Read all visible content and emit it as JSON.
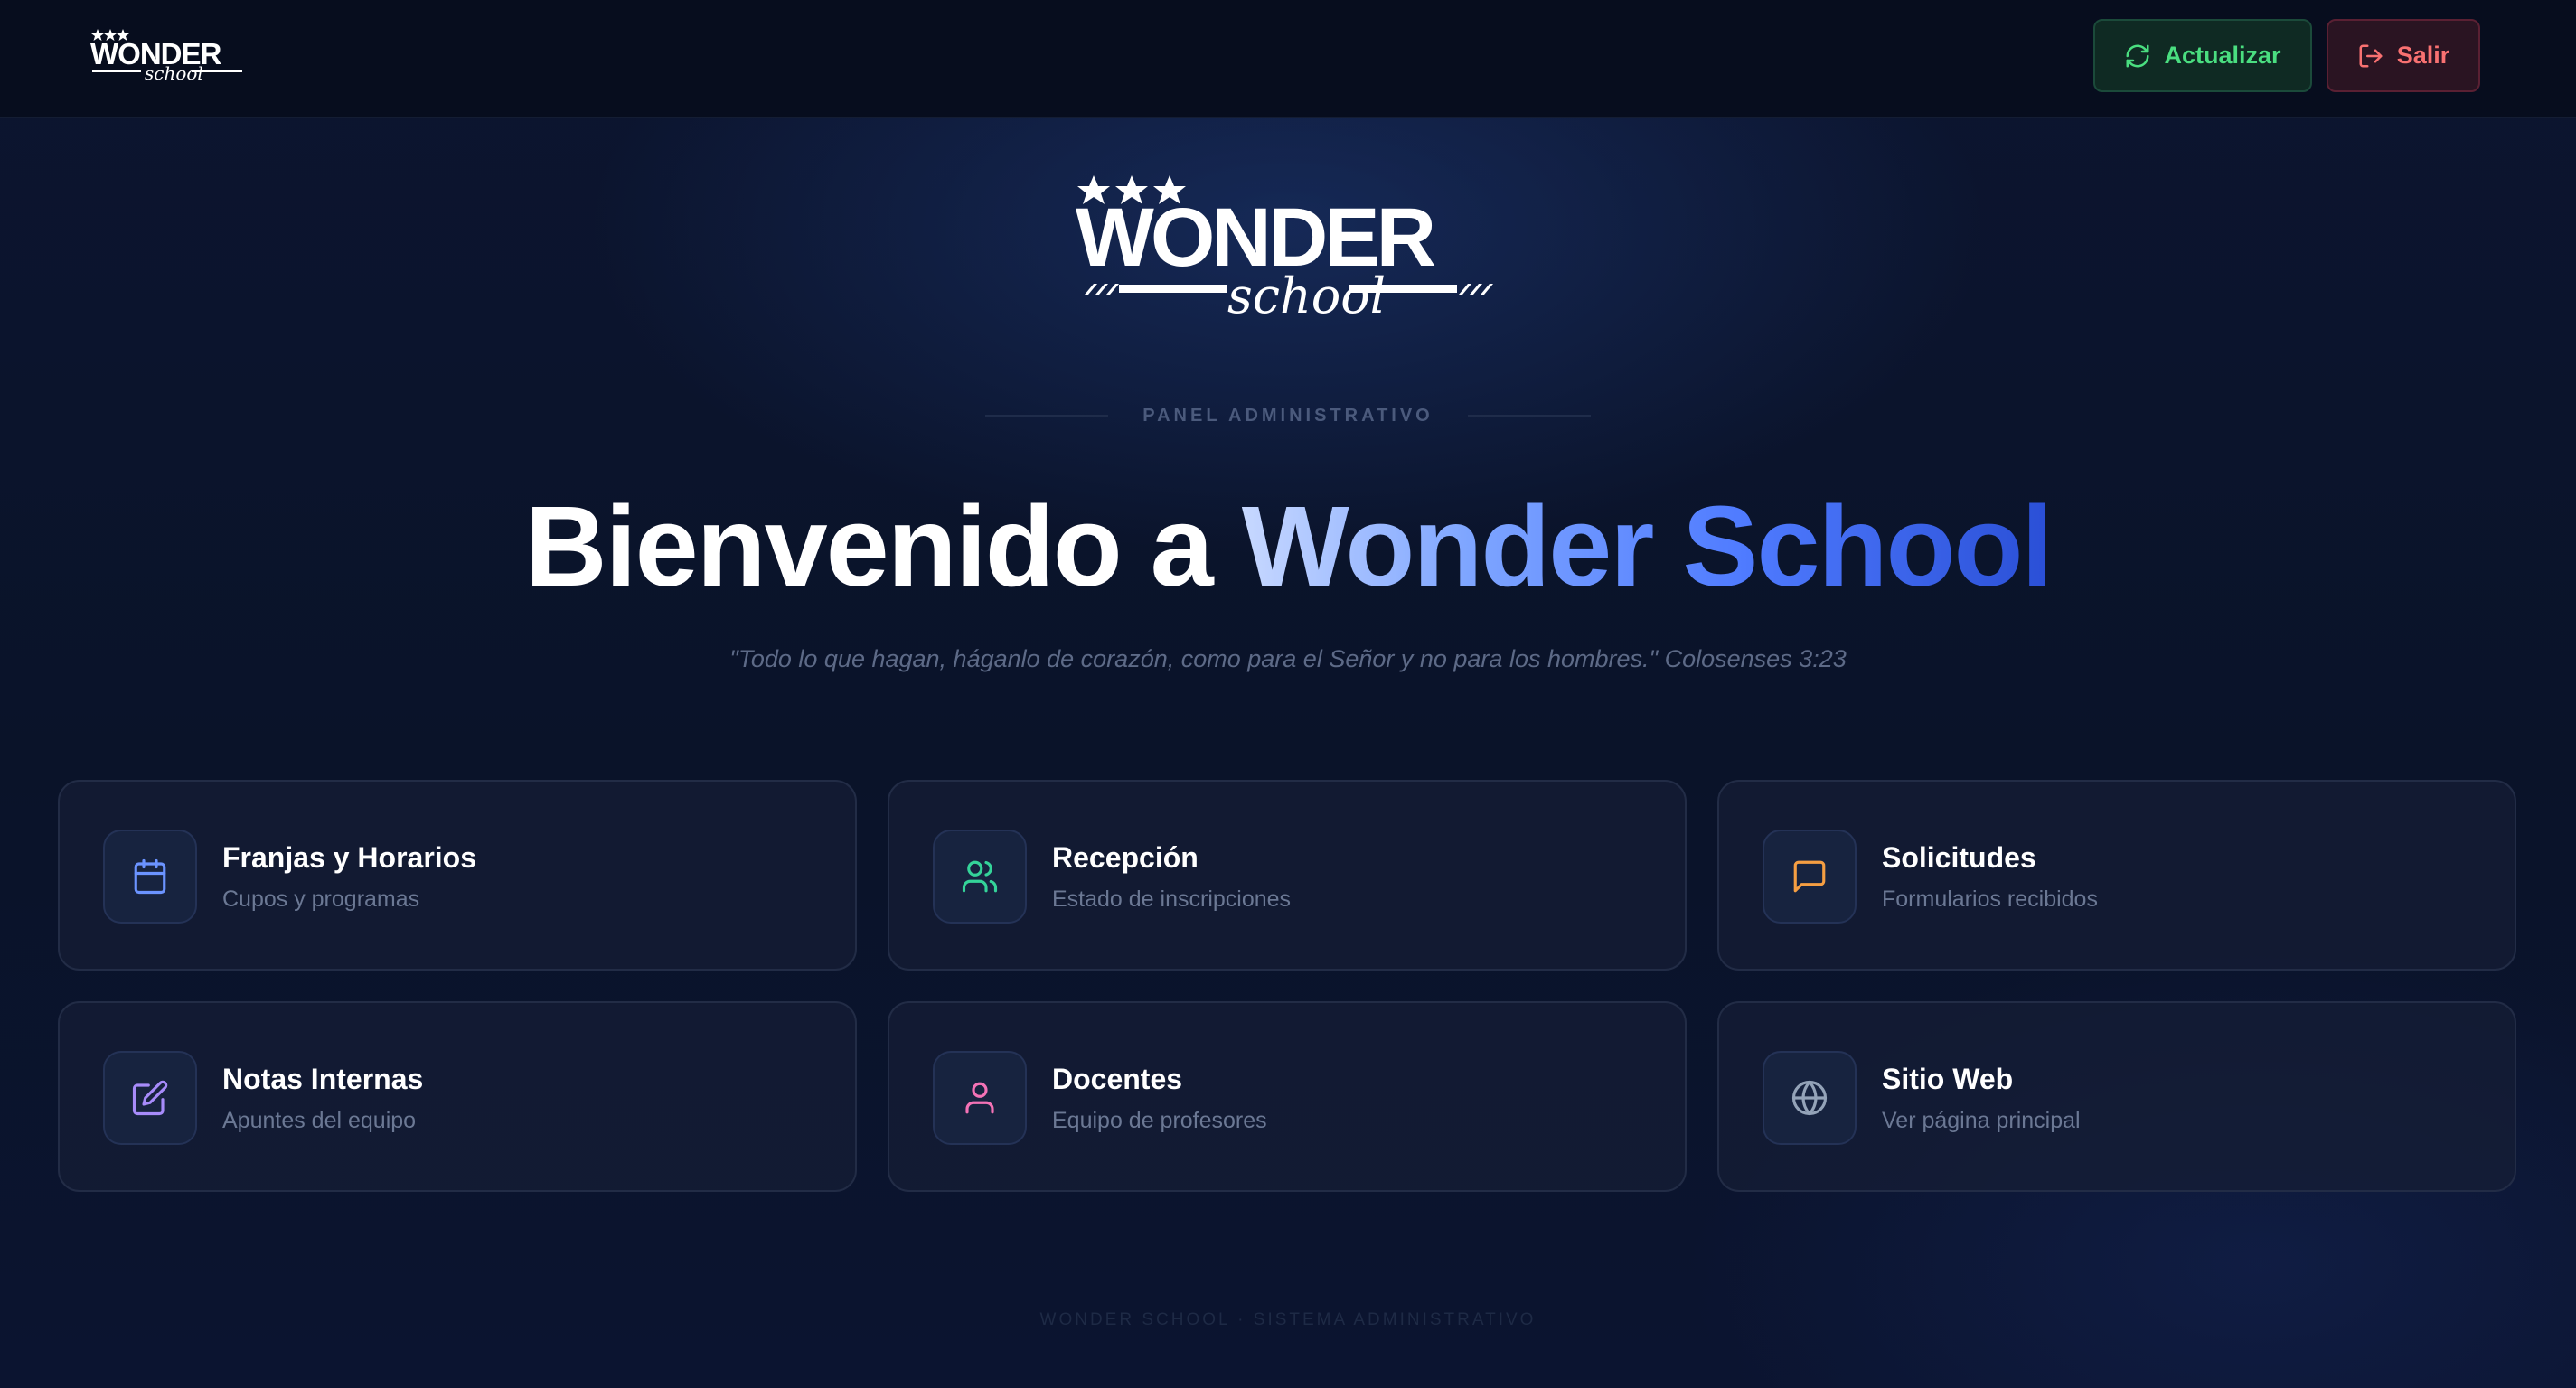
{
  "header": {
    "refresh_label": "Actualizar",
    "logout_label": "Salir"
  },
  "hero": {
    "eyebrow": "PANEL ADMINISTRATIVO",
    "headline_prefix": "Bienvenido a ",
    "headline_accent": "Wonder School",
    "quote": "\"Todo lo que hagan, háganlo de corazón, como para el Señor y no para los hombres.\" Colosenses 3:23"
  },
  "cards": [
    {
      "title": "Franjas y Horarios",
      "subtitle": "Cupos y programas",
      "icon": "calendar-icon",
      "color": "#6b93ff"
    },
    {
      "title": "Recepción",
      "subtitle": "Estado de inscripciones",
      "icon": "users-icon",
      "color": "#34d399"
    },
    {
      "title": "Solicitudes",
      "subtitle": "Formularios recibidos",
      "icon": "message-icon",
      "color": "#f59e42"
    },
    {
      "title": "Notas Internas",
      "subtitle": "Apuntes del equipo",
      "icon": "edit-icon",
      "color": "#a78bfa"
    },
    {
      "title": "Docentes",
      "subtitle": "Equipo de profesores",
      "icon": "user-icon",
      "color": "#f472b6"
    },
    {
      "title": "Sitio Web",
      "subtitle": "Ver página principal",
      "icon": "globe-icon",
      "color": "#94a3b8"
    }
  ],
  "footer": {
    "text": "WONDER SCHOOL · SISTEMA ADMINISTRATIVO"
  },
  "colors": {
    "background": "#0b1326",
    "accent_blue": "#4f7bff",
    "refresh_green": "#4ade80",
    "logout_red": "#f87171"
  }
}
